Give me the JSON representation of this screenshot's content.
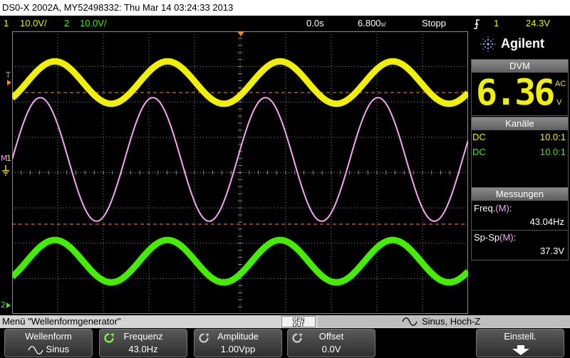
{
  "title_bar": {
    "text": "DS0-X 2002A, MY52498332: Thu Mar 14 03:24:33 2013"
  },
  "status": {
    "ch1_num": "1",
    "ch1_scale": "10.0V/",
    "ch2_num": "2",
    "ch2_scale": "10.0V/",
    "time_offset": "0.0s",
    "time_scale": "6.800",
    "time_scale_unit": "s/",
    "run_state": "Stopp",
    "trigger_source": "1",
    "trigger_level": "24.3V"
  },
  "markers": {
    "trigger": "T",
    "math": "M",
    "ch1": "1",
    "ch2": "2"
  },
  "brand": {
    "name": "Agilent"
  },
  "dvm": {
    "title": "DVM",
    "value": "6.36",
    "mode": "AC",
    "unit": "V"
  },
  "channels": {
    "title": "Kanäle",
    "rows": [
      {
        "coupling": "DC",
        "ratio": "10.0:1"
      },
      {
        "coupling": "DC",
        "ratio": "10.0:1"
      }
    ]
  },
  "measurements": {
    "title": "Messungen",
    "freq_label": "Freq.",
    "freq_src": "(M)",
    "freq_suffix": ":",
    "freq_value": "43.04Hz",
    "pp_label": "Sp-Sp",
    "pp_src": "(M)",
    "pp_suffix": ":",
    "pp_value": "37.3V"
  },
  "menu": {
    "title": "Menü \"Wellenformgenerator\"",
    "gen_out_top": "GEN",
    "gen_out_bottom": "OUT",
    "output_state": "Sinus, Hoch-Z"
  },
  "softkeys": {
    "waveform_label": "Wellenform",
    "waveform_value": "Sinus",
    "frequency_label": "Frequenz",
    "frequency_value": "43.0Hz",
    "amplitude_label": "Amplitude",
    "amplitude_value": "1.00Vpp",
    "offset_label": "Offset",
    "offset_value": "0.0V",
    "settings_label": "Einstell."
  },
  "colors": {
    "ch1": "#f0f000",
    "ch2": "#44ee00",
    "math": "#f7a6f2",
    "trigger": "#ff8a2a",
    "grid": "#8a8a8a",
    "label_blue": "#7fb0ff"
  },
  "waveforms": {
    "ch1_amplitude_div": 0.6,
    "ch2_amplitude_div": 0.6,
    "math_amplitude_div": 1.75,
    "cycles_on_screen": 4.05
  },
  "icons": {
    "brand": "agilent-spark-icon",
    "trigger_edge": "rising-edge-icon",
    "settings_arrow": "down-arrow-icon",
    "sine": "sine-icon",
    "knob": "rotary-knob-icon"
  }
}
